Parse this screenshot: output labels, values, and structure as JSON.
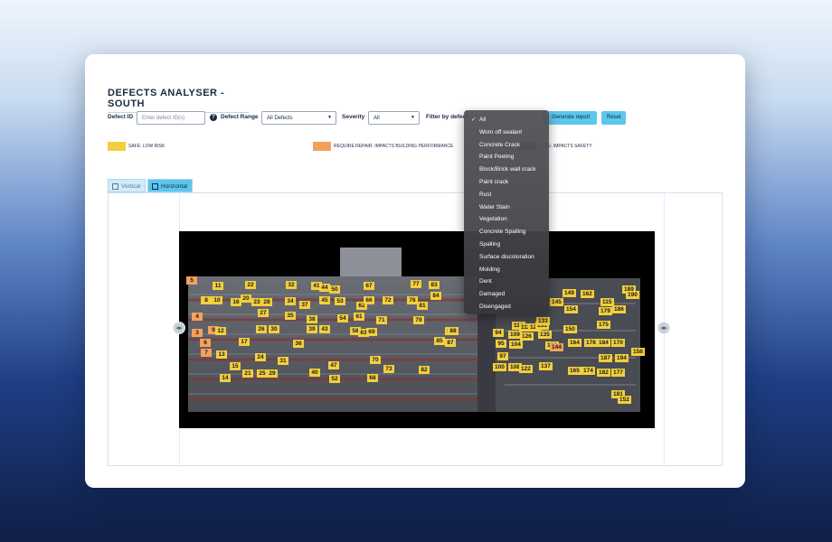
{
  "page": {
    "title": "DEFECTS ANALYSER - SOUTH"
  },
  "filters": {
    "defect_id_label": "Defect ID",
    "defect_id_placeholder": "Enter defect ID(s)",
    "defect_range_label": "Defect Range",
    "defect_range_value": "All Defects",
    "severity_label": "Severity",
    "severity_value": "All",
    "filter_by_defect_label": "Filter by defect",
    "generate_report_label": "Generate report",
    "reset_label": "Reset"
  },
  "legend": [
    {
      "color": "#f2cf3d",
      "label": "SAFE: LOW RISK"
    },
    {
      "color": "#f4a15c",
      "label": "REQUIRE REPAIR: IMPACTS BUILDING PERFORMANCE"
    },
    {
      "color": "#e85757",
      "label": "SAFE: IMPACTS SAFETY"
    }
  ],
  "view_tabs": [
    {
      "label": "Vertical",
      "icon": "columns-icon",
      "active": false
    },
    {
      "label": "Horizontal",
      "icon": "rows-icon",
      "active": true
    }
  ],
  "defect_menu": {
    "options": [
      "All",
      "Worn off sealant",
      "Concrete Crack",
      "Paint Peeling",
      "Block/Brick wall crack",
      "Paint crack",
      "Rust",
      "Water Stain",
      "Vegetation",
      "Concrete Spalling",
      "Spalling",
      "Surface discoloration",
      "Molding",
      "Dent",
      "Damaged",
      "Disengaged"
    ],
    "selected": "All"
  },
  "colors": {
    "accent": "#5cc6ec",
    "yellow_marker": "#f2cf3d",
    "orange_marker": "#f4a15c"
  },
  "markers": [
    {
      "id": "5",
      "c": "o"
    },
    {
      "id": "11",
      "c": "y"
    },
    {
      "id": "22",
      "c": "y"
    },
    {
      "id": "32",
      "c": "y"
    },
    {
      "id": "41",
      "c": "y"
    },
    {
      "id": "44",
      "c": "y"
    },
    {
      "id": "50",
      "c": "y"
    },
    {
      "id": "67",
      "c": "y"
    },
    {
      "id": "77",
      "c": "y"
    },
    {
      "id": "83",
      "c": "y"
    },
    {
      "id": "8",
      "c": "y"
    },
    {
      "id": "10",
      "c": "y"
    },
    {
      "id": "16",
      "c": "y"
    },
    {
      "id": "20",
      "c": "y"
    },
    {
      "id": "23",
      "c": "y"
    },
    {
      "id": "28",
      "c": "y"
    },
    {
      "id": "34",
      "c": "y"
    },
    {
      "id": "37",
      "c": "y"
    },
    {
      "id": "45",
      "c": "y"
    },
    {
      "id": "53",
      "c": "y"
    },
    {
      "id": "62",
      "c": "y"
    },
    {
      "id": "66",
      "c": "y"
    },
    {
      "id": "72",
      "c": "y"
    },
    {
      "id": "76",
      "c": "y"
    },
    {
      "id": "84",
      "c": "y"
    },
    {
      "id": "81",
      "c": "y"
    },
    {
      "id": "4",
      "c": "o"
    },
    {
      "id": "27",
      "c": "y"
    },
    {
      "id": "35",
      "c": "y"
    },
    {
      "id": "38",
      "c": "y"
    },
    {
      "id": "54",
      "c": "y"
    },
    {
      "id": "61",
      "c": "y"
    },
    {
      "id": "71",
      "c": "y"
    },
    {
      "id": "79",
      "c": "y"
    },
    {
      "id": "3",
      "c": "o"
    },
    {
      "id": "9",
      "c": "o"
    },
    {
      "id": "12",
      "c": "y"
    },
    {
      "id": "26",
      "c": "y"
    },
    {
      "id": "30",
      "c": "y"
    },
    {
      "id": "39",
      "c": "y"
    },
    {
      "id": "43",
      "c": "y"
    },
    {
      "id": "58",
      "c": "y"
    },
    {
      "id": "63",
      "c": "y"
    },
    {
      "id": "69",
      "c": "y"
    },
    {
      "id": "86",
      "c": "y"
    },
    {
      "id": "88",
      "c": "y"
    },
    {
      "id": "6",
      "c": "o"
    },
    {
      "id": "17",
      "c": "y"
    },
    {
      "id": "36",
      "c": "y"
    },
    {
      "id": "85",
      "c": "y"
    },
    {
      "id": "87",
      "c": "y"
    },
    {
      "id": "7",
      "c": "o"
    },
    {
      "id": "13",
      "c": "y"
    },
    {
      "id": "24",
      "c": "y"
    },
    {
      "id": "31",
      "c": "y"
    },
    {
      "id": "47",
      "c": "y"
    },
    {
      "id": "70",
      "c": "y"
    },
    {
      "id": "15",
      "c": "y"
    },
    {
      "id": "21",
      "c": "y"
    },
    {
      "id": "25",
      "c": "y"
    },
    {
      "id": "29",
      "c": "y"
    },
    {
      "id": "40",
      "c": "y"
    },
    {
      "id": "73",
      "c": "y"
    },
    {
      "id": "82",
      "c": "y"
    },
    {
      "id": "14",
      "c": "y"
    },
    {
      "id": "52",
      "c": "y"
    },
    {
      "id": "68",
      "c": "y"
    },
    {
      "id": "94",
      "c": "y"
    },
    {
      "id": "95",
      "c": "y"
    },
    {
      "id": "97",
      "c": "y"
    },
    {
      "id": "100",
      "c": "y"
    },
    {
      "id": "104",
      "c": "y"
    },
    {
      "id": "108",
      "c": "y"
    },
    {
      "id": "109",
      "c": "y"
    },
    {
      "id": "110",
      "c": "y"
    },
    {
      "id": "112",
      "c": "y"
    },
    {
      "id": "122",
      "c": "y"
    },
    {
      "id": "126",
      "c": "y"
    },
    {
      "id": "128",
      "c": "y"
    },
    {
      "id": "131",
      "c": "y"
    },
    {
      "id": "133",
      "c": "y"
    },
    {
      "id": "135",
      "c": "y"
    },
    {
      "id": "137",
      "c": "y"
    },
    {
      "id": "139",
      "c": "y"
    },
    {
      "id": "144",
      "c": "o"
    },
    {
      "id": "145",
      "c": "y"
    },
    {
      "id": "149",
      "c": "y"
    },
    {
      "id": "150",
      "c": "y"
    },
    {
      "id": "154",
      "c": "y"
    },
    {
      "id": "162",
      "c": "y"
    },
    {
      "id": "175",
      "c": "y"
    },
    {
      "id": "179",
      "c": "y"
    },
    {
      "id": "186",
      "c": "y"
    },
    {
      "id": "189",
      "c": "y"
    },
    {
      "id": "190",
      "c": "y"
    },
    {
      "id": "115",
      "c": "y"
    },
    {
      "id": "164",
      "c": "y"
    },
    {
      "id": "178",
      "c": "y"
    },
    {
      "id": "184",
      "c": "y"
    },
    {
      "id": "170",
      "c": "y"
    },
    {
      "id": "187",
      "c": "y"
    },
    {
      "id": "194",
      "c": "y"
    },
    {
      "id": "158",
      "c": "y"
    },
    {
      "id": "165",
      "c": "y"
    },
    {
      "id": "174",
      "c": "y"
    },
    {
      "id": "182",
      "c": "y"
    },
    {
      "id": "177",
      "c": "y"
    },
    {
      "id": "181",
      "c": "y"
    },
    {
      "id": "152",
      "c": "y"
    }
  ]
}
